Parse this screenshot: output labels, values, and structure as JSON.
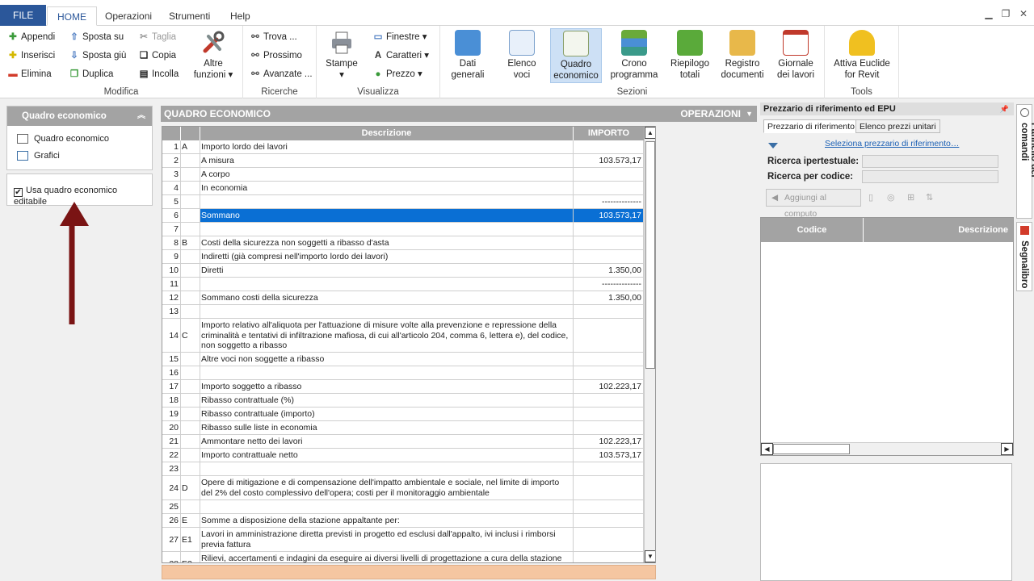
{
  "tabs": {
    "file": "FILE",
    "home": "HOME",
    "operazioni": "Operazioni",
    "strumenti": "Strumenti",
    "help": "Help"
  },
  "ribbon": {
    "modifica": {
      "label": "Modifica",
      "appendi": "Appendi",
      "inserisci": "Inserisci",
      "elimina": "Elimina",
      "sposta_su": "Sposta su",
      "sposta_giu": "Sposta giù",
      "duplica": "Duplica",
      "taglia": "Taglia",
      "copia": "Copia",
      "incolla": "Incolla",
      "altre_funzioni_1": "Altre",
      "altre_funzioni_2": "funzioni ▾"
    },
    "ricerche": {
      "label": "Ricerche",
      "trova": "Trova ...",
      "prossimo": "Prossimo",
      "avanzate": "Avanzate ..."
    },
    "visualizza": {
      "label": "Visualizza",
      "stampe": "Stampe",
      "finestre": "Finestre",
      "caratteri": "Caratteri",
      "prezzo": "Prezzo"
    },
    "sezioni": {
      "label": "Sezioni",
      "dati_1": "Dati",
      "dati_2": "generali",
      "elenco_1": "Elenco",
      "elenco_2": "voci",
      "quadro_1": "Quadro",
      "quadro_2": "economico",
      "crono_1": "Crono",
      "crono_2": "programma",
      "riepilogo_1": "Riepilogo",
      "riepilogo_2": "totali",
      "registro_1": "Registro",
      "registro_2": "documenti",
      "giornale_1": "Giornale",
      "giornale_2": "dei lavori"
    },
    "tools": {
      "label": "Tools",
      "euclide_1": "Attiva Euclide",
      "euclide_2": "for Revit"
    }
  },
  "left_panel": {
    "title": "Quadro economico",
    "item_quadro": "Quadro economico",
    "item_grafici": "Grafici",
    "checkbox_label": "Usa quadro economico editabile"
  },
  "center": {
    "title": "QUADRO ECONOMICO",
    "operations": "OPERAZIONI",
    "col_descrizione": "Descrizione",
    "col_importo": "IMPORTO",
    "rows": [
      {
        "n": "1",
        "l": "A",
        "d": "Importo lordo dei lavori",
        "i": "",
        "h": 17
      },
      {
        "n": "2",
        "l": "",
        "d": "A misura",
        "i": "103.573,17",
        "h": 17
      },
      {
        "n": "3",
        "l": "",
        "d": "A corpo",
        "i": "",
        "h": 17
      },
      {
        "n": "4",
        "l": "",
        "d": "In economia",
        "i": "",
        "h": 17
      },
      {
        "n": "5",
        "l": "",
        "d": "",
        "i": "--------------",
        "h": 17
      },
      {
        "n": "6",
        "l": "",
        "d": "Sommano",
        "i": "103.573,17",
        "h": 17,
        "sel": true
      },
      {
        "n": "7",
        "l": "",
        "d": "",
        "i": "",
        "h": 17
      },
      {
        "n": "8",
        "l": "B",
        "d": "Costi della sicurezza non soggetti a ribasso d'asta",
        "i": "",
        "h": 17
      },
      {
        "n": "9",
        "l": "",
        "d": "Indiretti (già compresi nell'importo lordo dei lavori)",
        "i": "",
        "h": 17
      },
      {
        "n": "10",
        "l": "",
        "d": "Diretti",
        "i": "1.350,00",
        "h": 17
      },
      {
        "n": "11",
        "l": "",
        "d": "",
        "i": "--------------",
        "h": 17
      },
      {
        "n": "12",
        "l": "",
        "d": "Sommano costi della sicurezza",
        "i": "1.350,00",
        "h": 17
      },
      {
        "n": "13",
        "l": "",
        "d": "",
        "i": "",
        "h": 17
      },
      {
        "n": "14",
        "l": "C",
        "d": "Importo relativo all'aliquota per l'attuazione di misure volte alla prevenzione e repressione della criminalità e tentativi di infiltrazione mafiosa, di cui all'articolo 204, comma 6, lettera e), del codice, non soggetto a ribasso",
        "i": "",
        "h": 42
      },
      {
        "n": "15",
        "l": "",
        "d": "Altre voci non soggette a ribasso",
        "i": "",
        "h": 17
      },
      {
        "n": "16",
        "l": "",
        "d": "",
        "i": "",
        "h": 17
      },
      {
        "n": "17",
        "l": "",
        "d": "Importo soggetto a ribasso",
        "i": "102.223,17",
        "h": 17
      },
      {
        "n": "18",
        "l": "",
        "d": "Ribasso contrattuale (%)",
        "i": "",
        "h": 17
      },
      {
        "n": "19",
        "l": "",
        "d": "Ribasso contrattuale (importo)",
        "i": "",
        "h": 17
      },
      {
        "n": "20",
        "l": "",
        "d": "Ribasso sulle liste in economia",
        "i": "",
        "h": 17
      },
      {
        "n": "21",
        "l": "",
        "d": "Ammontare netto dei lavori",
        "i": "102.223,17",
        "h": 17
      },
      {
        "n": "22",
        "l": "",
        "d": "Importo contrattuale netto",
        "i": "103.573,17",
        "h": 17
      },
      {
        "n": "23",
        "l": "",
        "d": "",
        "i": "",
        "h": 17
      },
      {
        "n": "24",
        "l": "D",
        "d": "Opere di mitigazione e di compensazione dell'impatto ambientale e sociale, nel limite di importo del 2% del costo complessivo dell'opera; costi per il monitoraggio ambientale",
        "i": "",
        "h": 30
      },
      {
        "n": "25",
        "l": "",
        "d": "",
        "i": "",
        "h": 17
      },
      {
        "n": "26",
        "l": "E",
        "d": "Somme a disposizione della stazione appaltante per:",
        "i": "",
        "h": 17
      },
      {
        "n": "27",
        "l": "E1",
        "d": "Lavori in amministrazione diretta previsti in progetto ed esclusi dall'appalto, ivi inclusi i rimborsi previa fattura",
        "i": "",
        "h": 30
      },
      {
        "n": "28",
        "l": "E2",
        "d": "Rilievi, accertamenti e indagini da eseguire ai diversi livelli di progettazione a cura della stazione",
        "i": "",
        "h": 30
      }
    ]
  },
  "right_panel": {
    "title": "Prezzario di riferimento ed EPU",
    "tab_prezzario": "Prezzario di riferimento",
    "tab_elenco": "Elenco prezzi unitari",
    "link": "Seleziona prezzario di riferimento…",
    "ricerca_ipertestuale": "Ricerca ipertestuale:",
    "ricerca_codice": "Ricerca per codice:",
    "aggiungi": "Aggiungi al computo",
    "col_codice": "Codice",
    "col_descrizione": "Descrizione"
  },
  "side_tabs": {
    "pannello": "Pannello dei comandi",
    "segnalibro": "Segnalibro"
  }
}
